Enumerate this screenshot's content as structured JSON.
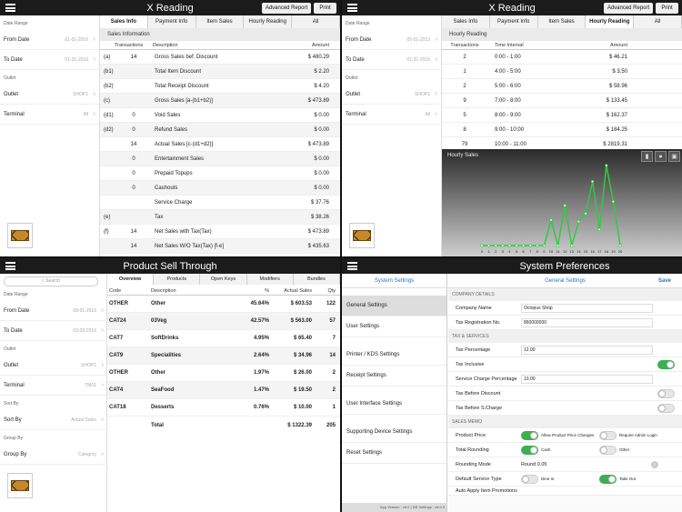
{
  "xreading1": {
    "title": "X Reading",
    "buttons": {
      "advanced": "Advanced Report",
      "print": "Print"
    },
    "sidebar": {
      "date_range_label": "Date Range",
      "from_label": "From Date",
      "from_value": "01-01-2016",
      "to_label": "To Date",
      "to_value": "01-31-2016",
      "outlet_section": "Outlet",
      "outlet_label": "Outlet",
      "outlet_value": "SHOP1",
      "terminal_label": "Terminal",
      "terminal_value": "All"
    },
    "tabs": [
      "Sales Info",
      "Payment Info",
      "Item Sales",
      "Hourly Reading",
      "All"
    ],
    "section": "Sales Information",
    "headers": {
      "code": "",
      "transactions": "Transactions",
      "description": "Description",
      "amount": "Amount"
    },
    "rows": [
      {
        "code": "(a)",
        "tx": "14",
        "desc": "Gross Sales bef. Discount",
        "amount": "$ 480.29"
      },
      {
        "code": "(b1)",
        "tx": "",
        "desc": "Total Item Discount",
        "amount": "$ 2.20"
      },
      {
        "code": "(b2)",
        "tx": "",
        "desc": "Total Receipt Discount",
        "amount": "$ 4.20"
      },
      {
        "code": "(c)",
        "tx": "",
        "desc": "Gross Sales [a-(b1+b2)]",
        "amount": "$ 473.89"
      },
      {
        "code": "(d1)",
        "tx": "0",
        "desc": "Void Sales",
        "amount": "$ 0.00"
      },
      {
        "code": "(d2)",
        "tx": "0",
        "desc": "Refund Sales",
        "amount": "$ 0.00"
      },
      {
        "code": "",
        "tx": "14",
        "desc": "Actual Sales [c-(d1+d2)]",
        "amount": "$ 473.89"
      },
      {
        "code": "",
        "tx": "0",
        "desc": "Entertainment Sales",
        "amount": "$ 0.00"
      },
      {
        "code": "",
        "tx": "0",
        "desc": "Prepaid Topups",
        "amount": "$ 0.00"
      },
      {
        "code": "",
        "tx": "0",
        "desc": "Cashouts",
        "amount": "$ 0.00"
      },
      {
        "code": "",
        "tx": "",
        "desc": "Service Charge",
        "amount": "$ 37.76"
      },
      {
        "code": "(e)",
        "tx": "",
        "desc": "Tax",
        "amount": "$ 38.26"
      },
      {
        "code": "(f)",
        "tx": "14",
        "desc": "Net Sales with Tax(Tax)",
        "amount": "$ 473.89"
      },
      {
        "code": "",
        "tx": "14",
        "desc": "Net Sales W/O Tax(Tax) [f-e]",
        "amount": "$ 435.63"
      }
    ]
  },
  "xreading2": {
    "title": "X Reading",
    "buttons": {
      "advanced": "Advanced Report",
      "print": "Print"
    },
    "sidebar": {
      "date_range_label": "Date Range",
      "from_label": "From Date",
      "from_value": "05-01-2013",
      "to_label": "To Date",
      "to_value": "01-31-2016",
      "outlet_section": "Outlet",
      "outlet_label": "Outlet",
      "outlet_value": "SHOP1",
      "terminal_label": "Terminal",
      "terminal_value": "All"
    },
    "tabs": [
      "Sales Info",
      "Payment Info",
      "Item Sales",
      "Hourly Reading",
      "All"
    ],
    "section": "Hourly Reading",
    "headers": {
      "transactions": "Transactions",
      "interval": "Time Interval",
      "amount": "Amount"
    },
    "rows": [
      {
        "tx": "2",
        "interval": "0:00 - 1:00",
        "amount": "$ 46.21"
      },
      {
        "tx": "1",
        "interval": "4:00 - 5:00",
        "amount": "$ 3.50"
      },
      {
        "tx": "2",
        "interval": "5:00 - 6:00",
        "amount": "$ 58.96"
      },
      {
        "tx": "9",
        "interval": "7:00 - 8:00",
        "amount": "$ 133.45"
      },
      {
        "tx": "5",
        "interval": "8:00 - 9:00",
        "amount": "$ 162.37"
      },
      {
        "tx": "8",
        "interval": "9:00 - 10:00",
        "amount": "$ 184.25"
      },
      {
        "tx": "79",
        "interval": "10:00 - 11:00",
        "amount": "$ 2819.31"
      }
    ],
    "chart": {
      "title": "Hourly Sales",
      "tools": [
        "bar-chart-icon",
        "pie-chart-icon",
        "image-icon"
      ]
    }
  },
  "chart_data": {
    "type": "line",
    "title": "Hourly Sales",
    "x": [
      "0",
      "1",
      "2",
      "3",
      "4",
      "5",
      "6",
      "7",
      "8",
      "9",
      "10",
      "11",
      "12",
      "13",
      "14",
      "15",
      "16",
      "17",
      "18",
      "19",
      "20"
    ],
    "series": [
      {
        "values": [
          0,
          0,
          0,
          0,
          0,
          0,
          0,
          0,
          0,
          0,
          0.32,
          0,
          0.5,
          0,
          0.3,
          0.4,
          0.8,
          0.2,
          1.0,
          0.55,
          0
        ]
      }
    ],
    "ylim": [
      0,
      1
    ],
    "xlabel": "",
    "ylabel": "",
    "line_color": "#2ecc40"
  },
  "pst": {
    "title": "Product Sell Through",
    "search_placeholder": "Search",
    "sidebar": {
      "date_range_label": "Date Range",
      "from_label": "From Date",
      "from_value": "08-01-2016",
      "to_label": "To Date",
      "to_value": "03-28-2016",
      "outlet_section": "Outlet",
      "outlet_label": "Outlet",
      "outlet_value": "SHOP1",
      "terminal_label": "Terminal",
      "terminal_value": "TM01",
      "sort_section": "Sort By",
      "sort_label": "Sort By",
      "sort_value": "Actual Sales",
      "group_section": "Group By",
      "group_label": "Group By",
      "group_value": "Category"
    },
    "tabs": [
      "Overview",
      "Products",
      "Open Keys",
      "Modifiers",
      "Bundles"
    ],
    "headers": {
      "code": "Code",
      "description": "Description",
      "pct": "%",
      "sales": "Actual Sales",
      "qty": "Qty"
    },
    "rows": [
      {
        "code": "OTHER",
        "desc": "Other",
        "pct": "45.64%",
        "sales": "$ 603.53",
        "qty": "122"
      },
      {
        "code": "CAT24",
        "desc": "03Veg",
        "pct": "42.57%",
        "sales": "$ 563.00",
        "qty": "57"
      },
      {
        "code": "CAT7",
        "desc": "SoftDrinks",
        "pct": "4.95%",
        "sales": "$ 65.40",
        "qty": "7"
      },
      {
        "code": "CAT9",
        "desc": "Specialities",
        "pct": "2.64%",
        "sales": "$ 34.96",
        "qty": "14"
      },
      {
        "code": "OTHER",
        "desc": "Other",
        "pct": "1.97%",
        "sales": "$ 26.00",
        "qty": "2"
      },
      {
        "code": "CAT4",
        "desc": "SeaFood",
        "pct": "1.47%",
        "sales": "$ 19.50",
        "qty": "2"
      },
      {
        "code": "CAT18",
        "desc": "Desserts",
        "pct": "0.76%",
        "sales": "$ 10.00",
        "qty": "1"
      }
    ],
    "total": {
      "label": "Total",
      "sales": "$ 1322.39",
      "qty": "205"
    }
  },
  "prefs": {
    "title": "System Preferences",
    "left_title": "System Settings",
    "right_title": "General Settings",
    "save": "Save",
    "menu": [
      "General Settings",
      "User Settings",
      "Printer / KDS Settings",
      "Receipt Settings",
      "User Interface Settings",
      "Supporting Device Settings",
      "Reset Settings"
    ],
    "footer": "App Version : v6.0   |   DB Settings : v6.0.3",
    "company_section": "COMPANY DETAILS",
    "company_name_label": "Company Name",
    "company_name": "Octopus Shop",
    "tax_reg_label": "Tax Registration No.",
    "tax_reg": "860000000",
    "tax_section": "TAX & SERVICES",
    "tax_pct_label": "Tax Percentage",
    "tax_pct": "12.00",
    "tax_inclusive_label": "Tax Inclusive",
    "service_label": "Service Charge Percentage",
    "service_pct": "10.00",
    "tax_before_discount_label": "Tax Before Discount",
    "tax_before_scharge_label": "Tax Before S.Charge",
    "memo_section": "SALES MEMO",
    "product_price_label": "Product Price",
    "allow_change": "Allow Product Price Changes",
    "require_admin": "Require Admin Login",
    "total_rounding_label": "Total Rounding",
    "cash": "Cash",
    "other": "Other",
    "rounding_mode_label": "Rounding Mode",
    "rounding_mode": "Round 0.05",
    "default_service_label": "Default Service Type",
    "dine_in": "Dine In",
    "take_out": "Take Out",
    "auto_label": "Auto Apply Item Promotions"
  }
}
